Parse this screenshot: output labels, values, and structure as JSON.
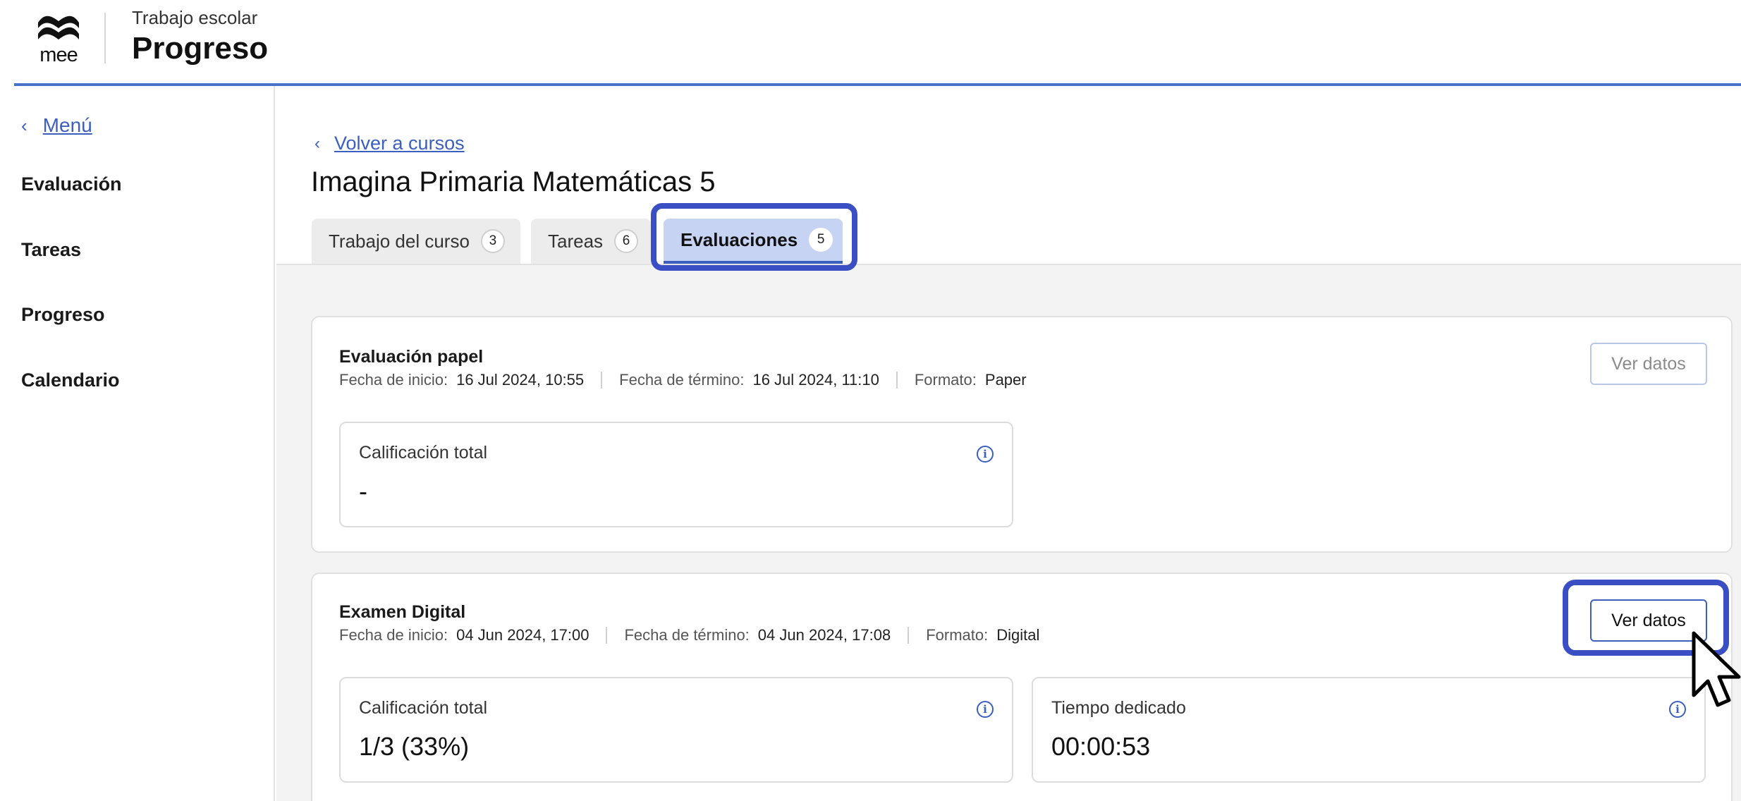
{
  "header": {
    "logo_text": "mee",
    "subtitle": "Trabajo escolar",
    "title": "Progreso"
  },
  "sidebar": {
    "back_label": "Menú",
    "items": [
      {
        "label": "Evaluación"
      },
      {
        "label": "Tareas"
      },
      {
        "label": "Progreso"
      },
      {
        "label": "Calendario"
      }
    ]
  },
  "main": {
    "back_link": "Volver a cursos",
    "course_title": "Imagina Primaria Matemáticas 5",
    "tabs": [
      {
        "label": "Trabajo del curso",
        "count": "3"
      },
      {
        "label": "Tareas",
        "count": "6"
      },
      {
        "label": "Evaluaciones",
        "count": "5",
        "active": true
      }
    ]
  },
  "assessments": [
    {
      "title": "Evaluación papel",
      "start_label": "Fecha de inicio:",
      "start": "16 Jul 2024, 10:55",
      "end_label": "Fecha de término:",
      "end": "16 Jul 2024, 11:10",
      "format_label": "Formato:",
      "format": "Paper",
      "button": "Ver datos",
      "button_enabled": false,
      "stats": [
        {
          "label": "Calificación total",
          "value": "-"
        }
      ]
    },
    {
      "title": "Examen Digital",
      "start_label": "Fecha de inicio:",
      "start": "04 Jun 2024, 17:00",
      "end_label": "Fecha de término:",
      "end": "04 Jun 2024, 17:08",
      "format_label": "Formato:",
      "format": "Digital",
      "button": "Ver datos",
      "button_enabled": true,
      "stats": [
        {
          "label": "Calificación total",
          "value": "1/3 (33%)"
        },
        {
          "label": "Tiempo dedicado",
          "value": "00:00:53"
        }
      ]
    }
  ],
  "icons": {
    "info": "info-circle-icon",
    "chevron": "chevron-left-icon",
    "cursor": "mouse-pointer-icon"
  },
  "colors": {
    "accent": "#3b5fbf",
    "highlight": "#3b4fc4",
    "active_tab": "#c6d3f2",
    "header_line": "#4a72c8"
  }
}
